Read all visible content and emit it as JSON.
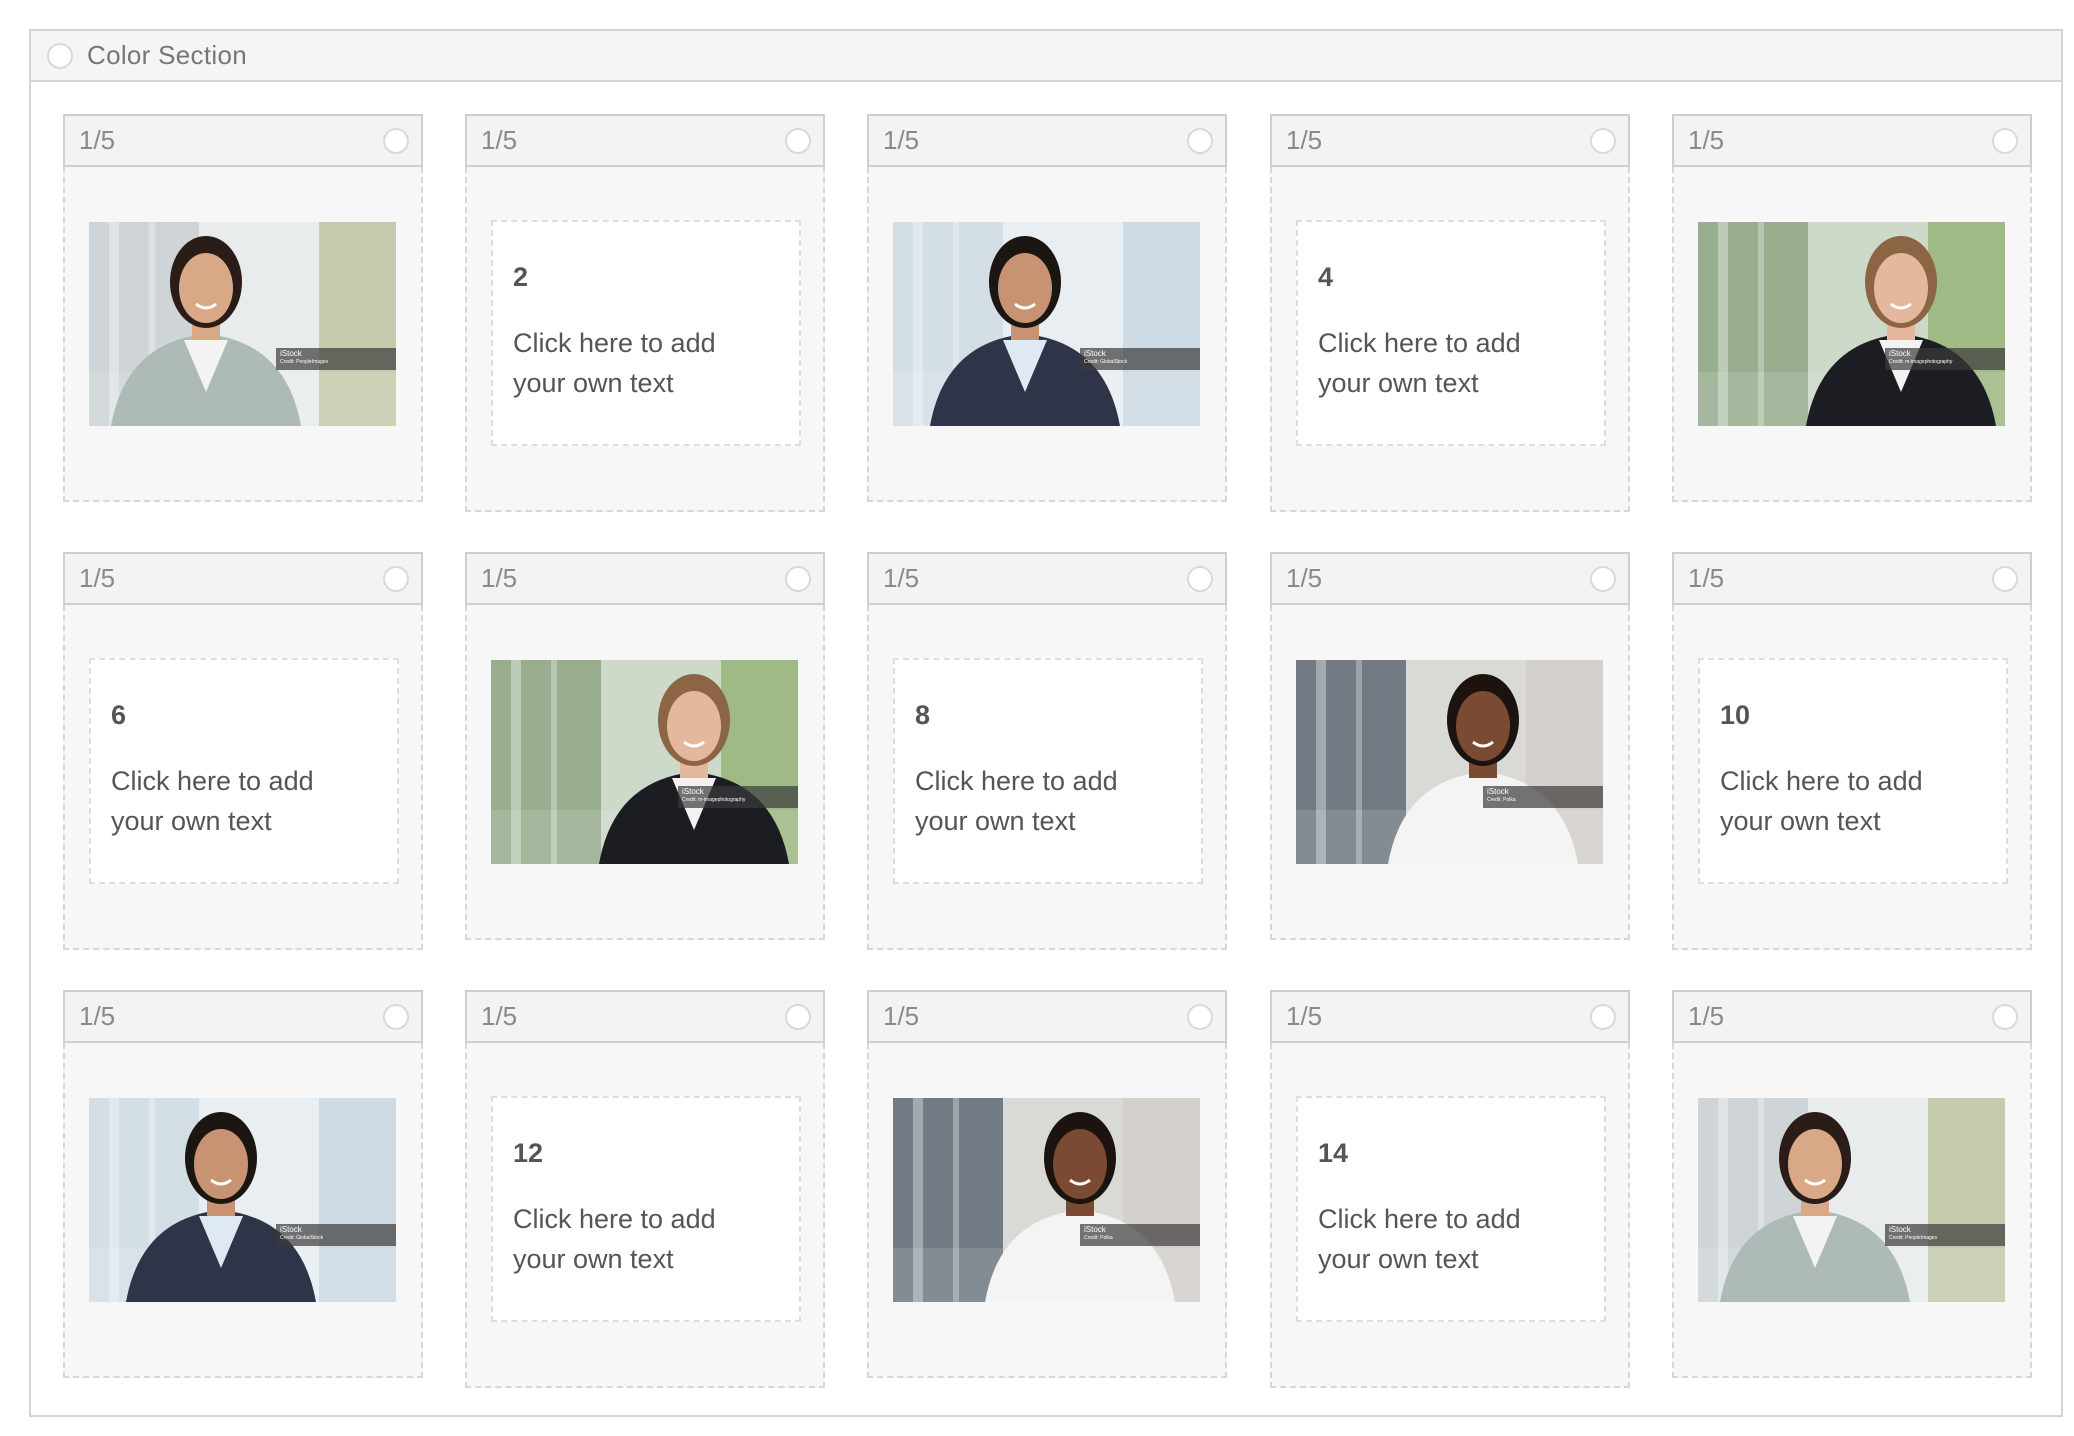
{
  "section": {
    "title": "Color Section"
  },
  "cards": [
    {
      "label": "1/5",
      "kind": "photo",
      "photo": "woman-gray-blazer",
      "badge": "iStock",
      "credit": "Credit: PeopleImages"
    },
    {
      "label": "1/5",
      "kind": "text",
      "number": "2",
      "line1": "Click here to add",
      "line2": "your own text"
    },
    {
      "label": "1/5",
      "kind": "photo",
      "photo": "man-navy-suit",
      "badge": "iStock",
      "credit": "Credit: GlobalStock"
    },
    {
      "label": "1/5",
      "kind": "text",
      "number": "4",
      "line1": "Click here to add",
      "line2": "your own text"
    },
    {
      "label": "1/5",
      "kind": "photo",
      "photo": "woman-black-blazer",
      "badge": "iStock",
      "credit": "Credit: m-imagephotography"
    },
    {
      "label": "1/5",
      "kind": "text",
      "number": "6",
      "line1": "Click here to add",
      "line2": "your own text"
    },
    {
      "label": "1/5",
      "kind": "photo",
      "photo": "woman-black-blazer",
      "badge": "iStock",
      "credit": "Credit: m-imagephotography"
    },
    {
      "label": "1/5",
      "kind": "text",
      "number": "8",
      "line1": "Click here to add",
      "line2": "your own text"
    },
    {
      "label": "1/5",
      "kind": "photo",
      "photo": "woman-white-shirt",
      "badge": "iStock",
      "credit": "Credit: Polka"
    },
    {
      "label": "1/5",
      "kind": "text",
      "number": "10",
      "line1": "Click here to add",
      "line2": "your own text"
    },
    {
      "label": "1/5",
      "kind": "photo",
      "photo": "man-navy-suit",
      "badge": "iStock",
      "credit": "Credit: GlobalStock"
    },
    {
      "label": "1/5",
      "kind": "text",
      "number": "12",
      "line1": "Click here to add",
      "line2": "your own text"
    },
    {
      "label": "1/5",
      "kind": "photo",
      "photo": "woman-white-shirt",
      "badge": "iStock",
      "credit": "Credit: Polka"
    },
    {
      "label": "1/5",
      "kind": "text",
      "number": "14",
      "line1": "Click here to add",
      "line2": "your own text"
    },
    {
      "label": "1/5",
      "kind": "photo",
      "photo": "woman-gray-blazer",
      "badge": "iStock",
      "credit": "Credit: PeopleImages"
    }
  ]
}
